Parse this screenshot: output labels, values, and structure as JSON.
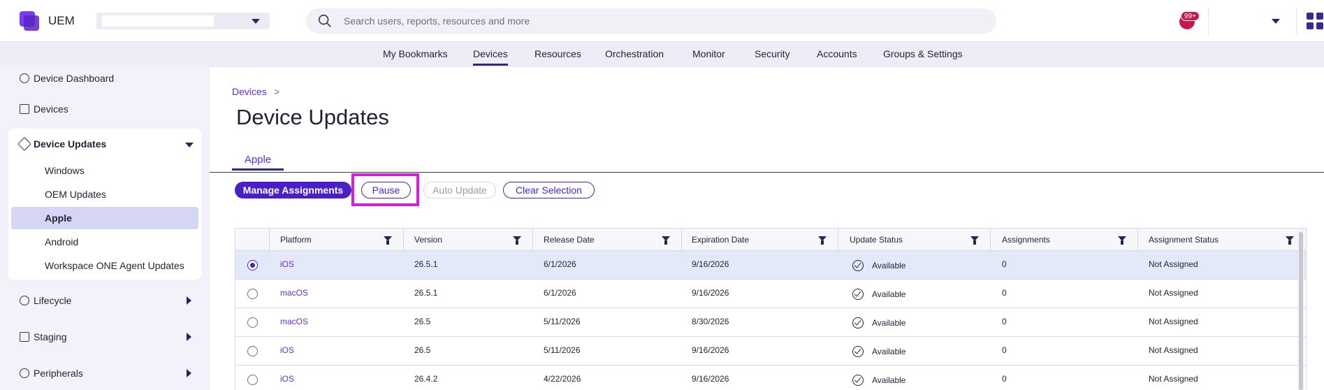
{
  "app": {
    "name": "UEM"
  },
  "header": {
    "search_placeholder": "Search users, reports, resources and more",
    "notification_badge": "99+"
  },
  "nav": {
    "items": [
      "My Bookmarks",
      "Devices",
      "Resources",
      "Orchestration",
      "Monitor",
      "Security",
      "Accounts",
      "Groups & Settings"
    ],
    "active": "Devices"
  },
  "sidebar": {
    "top_items": [
      "Device Dashboard",
      "Devices"
    ],
    "group": {
      "label": "Device Updates",
      "children": [
        "Windows",
        "OEM Updates",
        "Apple",
        "Android",
        "Workspace ONE Agent Updates"
      ],
      "active_child": "Apple"
    },
    "collapsed_items": [
      "Lifecycle",
      "Staging",
      "Peripherals"
    ]
  },
  "breadcrumb": {
    "root": "Devices",
    "separator": ">"
  },
  "page": {
    "title": "Device Updates"
  },
  "tabs": [
    {
      "label": "Apple",
      "active": true
    }
  ],
  "toolbar": {
    "manage": "Manage Assignments",
    "pause": "Pause",
    "auto_update": "Auto Update",
    "clear": "Clear Selection"
  },
  "table": {
    "columns": [
      "Platform",
      "Version",
      "Release Date",
      "Expiration Date",
      "Update Status",
      "Assignments",
      "Assignment Status"
    ],
    "rows": [
      {
        "selected": true,
        "platform": "iOS",
        "version": "26.5.1",
        "release": "6/1/2026",
        "expiration": "9/16/2026",
        "status": "Available",
        "assignments": "0",
        "assignment_status": "Not Assigned"
      },
      {
        "selected": false,
        "platform": "macOS",
        "version": "26.5.1",
        "release": "6/1/2026",
        "expiration": "9/16/2026",
        "status": "Available",
        "assignments": "0",
        "assignment_status": "Not Assigned"
      },
      {
        "selected": false,
        "platform": "macOS",
        "version": "26.5",
        "release": "5/11/2026",
        "expiration": "8/30/2026",
        "status": "Available",
        "assignments": "0",
        "assignment_status": "Not Assigned"
      },
      {
        "selected": false,
        "platform": "iOS",
        "version": "26.5",
        "release": "5/11/2026",
        "expiration": "9/16/2026",
        "status": "Available",
        "assignments": "0",
        "assignment_status": "Not Assigned"
      },
      {
        "selected": false,
        "platform": "iOS",
        "version": "26.4.2",
        "release": "4/22/2026",
        "expiration": "9/16/2026",
        "status": "Available",
        "assignments": "0",
        "assignment_status": "Not Assigned"
      }
    ]
  },
  "colors": {
    "accent": "#4b1fc7",
    "link": "#6a2bd0",
    "highlight": "#d81be0",
    "nav_bg": "#eeecf7",
    "selected_row": "#e4e9fa"
  }
}
